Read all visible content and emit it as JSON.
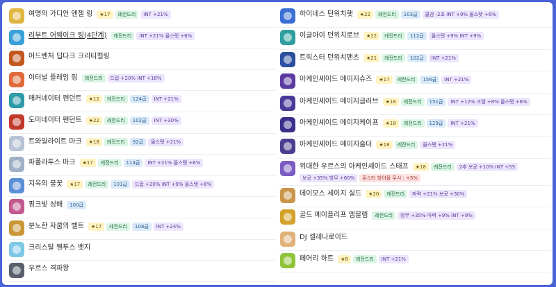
{
  "left_items": [
    {
      "name": "여명의 가디언 엔젤 링",
      "icon": "ring-icon",
      "color": "#e0b642",
      "star": "★17",
      "grade": "레전드리",
      "opts": [
        "INT +21%"
      ]
    },
    {
      "name": "리부트 어웨이크 링(4단계)",
      "icon": "ring-icon",
      "color": "#3aa0d8",
      "link": true,
      "grade": "레전드리",
      "opts": [
        "INT +21% 올스탯 +6%"
      ]
    },
    {
      "name": "어드벤처 딥다크 크리티컬링",
      "icon": "ring-icon",
      "color": "#c2581f"
    },
    {
      "name": "이터널 플레임 링",
      "icon": "ring-icon",
      "color": "#e06a3a",
      "grade": "레전드리",
      "opts": [
        "드랍 +20% INT +18%"
      ]
    },
    {
      "name": "매커네이터 펜던트",
      "icon": "pendant-icon",
      "color": "#2f9aa8",
      "star": "★12",
      "grade": "레전드리",
      "level": "124급",
      "opts": [
        "INT +21%"
      ]
    },
    {
      "name": "도미네이터 펜던트",
      "icon": "pendant-icon",
      "color": "#c0392b",
      "star": "★22",
      "grade": "레전드리",
      "level": "102급",
      "opts": [
        "INT +30%"
      ]
    },
    {
      "name": "트와일라이트 마크",
      "icon": "face-accessory-icon",
      "color": "#b9c3d6",
      "star": "★18",
      "grade": "레전드리",
      "level": "92급",
      "opts": [
        "올스탯 +21%"
      ]
    },
    {
      "name": "파풀라투스 마크",
      "icon": "eye-accessory-icon",
      "color": "#9fb0c6",
      "star": "★17",
      "grade": "레전드리",
      "level": "114급",
      "opts": [
        "INT +21% 올스탯 +6%"
      ]
    },
    {
      "name": "지옥의 불꽃",
      "icon": "earring-icon",
      "color": "#5b8fd6",
      "star": "★17",
      "grade": "레전드리",
      "level": "101급",
      "opts": [
        "드랍 +20% INT +9% 올스탯 +6%"
      ]
    },
    {
      "name": "핑크빛 성배",
      "icon": "pocket-item-icon",
      "color": "#c25a8f",
      "level": "100급"
    },
    {
      "name": "분노한 자쿰의 벨트",
      "icon": "belt-icon",
      "color": "#c99636",
      "star": "★17",
      "grade": "레전드리",
      "level": "108급",
      "opts": [
        "INT +24%"
      ]
    },
    {
      "name": "크리스탈 웬투스 뱃지",
      "icon": "badge-icon",
      "color": "#7ec8e6"
    },
    {
      "name": "우르스 격파왕",
      "icon": "medal-icon",
      "color": "#5a5f6e"
    }
  ],
  "right_items": [
    {
      "name": "하이네스 던위치햇",
      "icon": "hat-icon",
      "color": "#3b6fd4",
      "star": "★22",
      "grade": "레전드리",
      "level": "103급",
      "opts": [
        "쿨감 -2초 INT +9% 올스탯 +6%"
      ]
    },
    {
      "name": "이글아이 던위치로브",
      "icon": "robe-icon",
      "color": "#2f9fa0",
      "star": "★22",
      "grade": "레전드리",
      "level": "112급",
      "opts": [
        "올스탯 +9% INT +9%"
      ]
    },
    {
      "name": "트릭스터 던위치팬츠",
      "icon": "pants-icon",
      "color": "#2c4fa0",
      "star": "★21",
      "grade": "레전드리",
      "level": "102급",
      "opts": [
        "INT +21%"
      ]
    },
    {
      "name": "아케인셰이드 메이지슈즈",
      "icon": "shoes-icon",
      "color": "#5a3aa0",
      "star": "★17",
      "grade": "레전드리",
      "level": "156급",
      "opts": [
        "INT +21%"
      ]
    },
    {
      "name": "아케인셰이드 메이지글러브",
      "icon": "glove-icon",
      "color": "#4a3a9a",
      "star": "★18",
      "grade": "레전드리",
      "level": "151급",
      "opts": [
        "INT +12% 크뎀 +8% 올스탯 +6%"
      ]
    },
    {
      "name": "아케인셰이드 메이지케이프",
      "icon": "cape-icon",
      "color": "#3a2f8a",
      "star": "★18",
      "grade": "레전드리",
      "level": "129급",
      "opts": [
        "INT +21%"
      ]
    },
    {
      "name": "아케인셰이드 메이지숄더",
      "icon": "shoulder-icon",
      "color": "#4b3d8f",
      "star": "★18",
      "grade": "레전드리",
      "opts": [
        "올스탯 +21%"
      ]
    },
    {
      "name": "위대한 우르스의 아케인셰이드 스태프",
      "icon": "staff-icon",
      "color": "#7a5bc2",
      "tall": true,
      "star": "★18",
      "grade": "레전드리",
      "opts": [
        "2추 보공 +10% INT +55",
        "보공 +35% 방무 +60%"
      ],
      "red_opts": [
        "몬스터 방어율 무시 : +5%"
      ]
    },
    {
      "name": "데이모스 세이지 실드",
      "icon": "shield-icon",
      "color": "#c9954a",
      "star": "★20",
      "grade": "레전드리",
      "opts": [
        "마력 +21% 보공 +30%"
      ]
    },
    {
      "name": "골드 메이플리프 엠블렘",
      "icon": "emblem-icon",
      "color": "#d4a12a",
      "grade": "레전드리",
      "opts": [
        "방무 +35% 마력 +9% INT +9%"
      ]
    },
    {
      "name": "DJ 셀레나로이드",
      "icon": "android-icon",
      "color": "#e0b27a"
    },
    {
      "name": "페어리 하트",
      "icon": "heart-icon",
      "color": "#8fc43a",
      "star": "★8",
      "grade": "레전드리",
      "opts": [
        "INT +21%"
      ]
    }
  ]
}
